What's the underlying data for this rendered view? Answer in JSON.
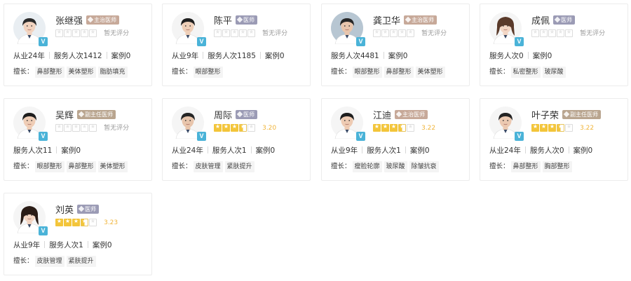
{
  "labels": {
    "specialty_prefix": "擅长："
  },
  "colors": {
    "star_on": "#f3c53a",
    "score_text": "#f0b43a",
    "verified_badge": "#4ab3d8",
    "tag_yishi": "#9b9bb5",
    "tag_zhuzhi": "#c7a999",
    "tag_fuzhuren": "#b9a58f"
  },
  "doctors": [
    {
      "name": "张继强",
      "title": "主治医师",
      "title_style": "zhuzhi",
      "verified": "V",
      "stars": 0,
      "rating_text": "暂无评分",
      "stats": [
        "从业24年",
        "服务人次1412",
        "案例0"
      ],
      "specialties": [
        "鼻部整形",
        "美体塑形",
        "脂肪填充"
      ]
    },
    {
      "name": "陈平",
      "title": "医师",
      "title_style": "yishi",
      "verified": "V",
      "stars": 0,
      "rating_text": "暂无评分",
      "stats": [
        "从业9年",
        "服务人次1185",
        "案例0"
      ],
      "specialties": [
        "眼部整形"
      ]
    },
    {
      "name": "龚卫华",
      "title": "主治医师",
      "title_style": "zhuzhi",
      "verified": "V",
      "stars": 0,
      "rating_text": "暂无评分",
      "stats": [
        "服务人次4481",
        "案例0"
      ],
      "specialties": [
        "眼部整形",
        "鼻部整形",
        "美体塑形"
      ]
    },
    {
      "name": "成佩",
      "title": "医师",
      "title_style": "yishi",
      "verified": "V",
      "stars": 0,
      "rating_text": "暂无评分",
      "stats": [
        "服务人次0",
        "案例0"
      ],
      "specialties": [
        "私密整形",
        "玻尿酸"
      ]
    },
    {
      "name": "吴辉",
      "title": "副主任医师",
      "title_style": "fuzhuren",
      "verified": "V",
      "stars": 0,
      "rating_text": "暂无评分",
      "stats": [
        "服务人次11",
        "案例0"
      ],
      "specialties": [
        "眼部整形",
        "鼻部整形",
        "美体塑形"
      ]
    },
    {
      "name": "周际",
      "title": "医师",
      "title_style": "yishi",
      "verified": "V",
      "stars": 3.2,
      "rating_text": "3.20",
      "stats": [
        "从业24年",
        "服务人次1",
        "案例0"
      ],
      "specialties": [
        "皮肤管理",
        "紧肤提升"
      ]
    },
    {
      "name": "江迪",
      "title": "主治医师",
      "title_style": "zhuzhi",
      "verified": "V",
      "stars": 3.22,
      "rating_text": "3.22",
      "stats": [
        "从业9年",
        "服务人次1",
        "案例0"
      ],
      "specialties": [
        "瘦脸轮廓",
        "玻尿酸",
        "除皱抗衰"
      ]
    },
    {
      "name": "叶子荣",
      "title": "副主任医师",
      "title_style": "fuzhuren",
      "verified": "V",
      "stars": 3.22,
      "rating_text": "3.22",
      "stats": [
        "从业24年",
        "服务人次0",
        "案例0"
      ],
      "specialties": [
        "鼻部整形",
        "胸部整形"
      ]
    },
    {
      "name": "刘英",
      "title": "医师",
      "title_style": "yishi",
      "verified": "V",
      "stars": 3.23,
      "rating_text": "3.23",
      "stats": [
        "从业9年",
        "服务人次1",
        "案例0"
      ],
      "specialties": [
        "皮肤管理",
        "紧肤提升"
      ]
    }
  ]
}
